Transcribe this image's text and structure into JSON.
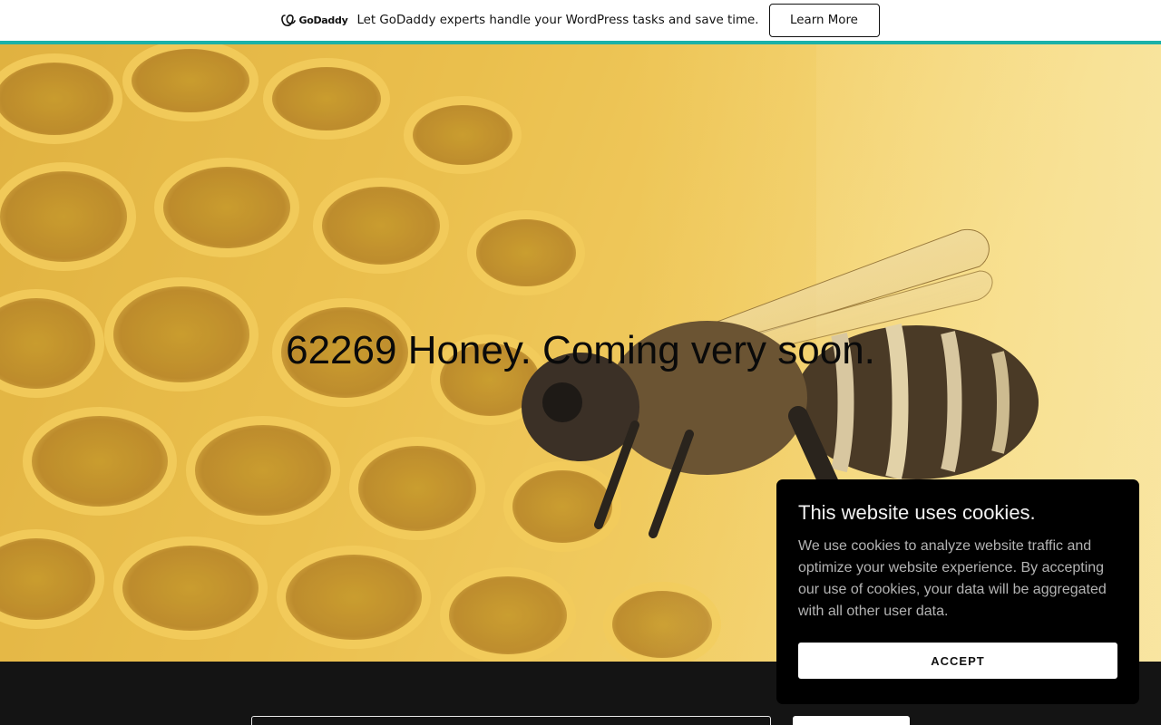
{
  "promo_bar": {
    "logo_text": "GoDaddy",
    "logo_icon": "godaddy-logo-icon",
    "message": "Let GoDaddy experts handle your WordPress tasks and save time.",
    "button_label": "Learn More",
    "accent_color": "#1bb1a8"
  },
  "hero": {
    "title": "62269 Honey. Coming very soon.",
    "image": "honeycomb-with-bee"
  },
  "footer": {
    "email_placeholder": "",
    "signup_label": ""
  },
  "cookie_banner": {
    "title": "This website uses cookies.",
    "body": "We use cookies to analyze website traffic and optimize your website experience. By accepting our use of cookies, your data will be aggregated with all other user data.",
    "accept_label": "ACCEPT"
  }
}
